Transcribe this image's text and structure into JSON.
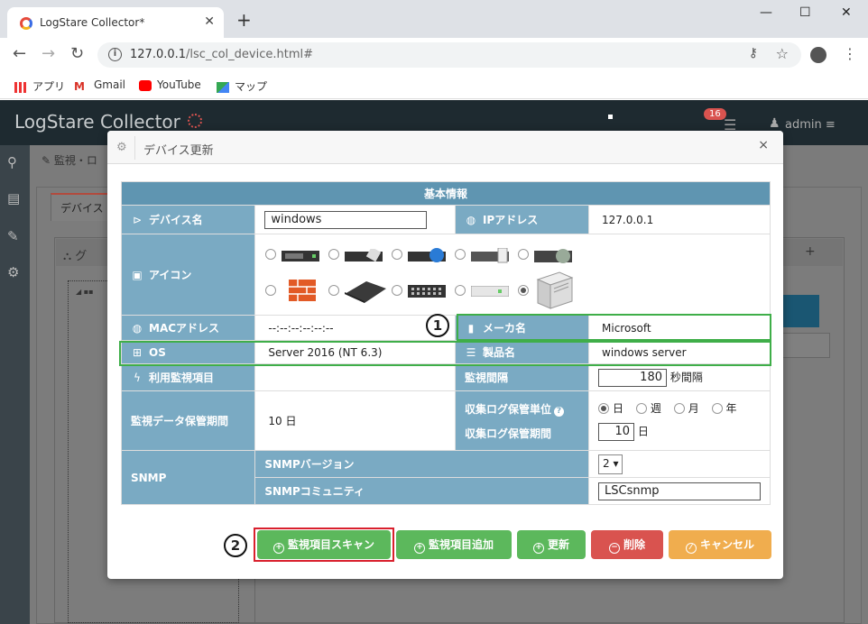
{
  "browser": {
    "tab_title": "LogStare Collector*",
    "url_host": "127.0.0.1",
    "url_path": "/lsc_col_device.html#",
    "bookmarks": [
      "アプリ",
      "Gmail",
      "YouTube",
      "マップ"
    ]
  },
  "app": {
    "title": "LogStare Collector",
    "notification_count": "16",
    "user": "admin",
    "breadcrumb": "監視・ロ",
    "bg_tab": "デバイス",
    "bg_panel_label": "グ"
  },
  "modal": {
    "title": "デバイス更新",
    "close": "×",
    "section_title": "基本情報",
    "rows": {
      "device_name_label": "デバイス名",
      "device_name_value": "windows",
      "ip_label": "IPアドレス",
      "ip_value": "127.0.0.1",
      "icon_label": "アイコン",
      "mac_label": "MACアドレス",
      "mac_value": "--:--:--:--:--:--",
      "maker_label": "メーカ名",
      "maker_value": "Microsoft",
      "os_label": "OS",
      "os_value": "Server 2016 (NT 6.3)",
      "product_label": "製品名",
      "product_value": "windows server",
      "used_items_label": "利用監視項目",
      "interval_label": "監視間隔",
      "interval_value": "180",
      "interval_unit": "秒間隔",
      "retention_label": "監視データ保管期間",
      "retention_value": "10 日",
      "log_unit_label": "収集ログ保管単位",
      "log_period_label": "収集ログ保管期間",
      "log_period_value": "10",
      "log_period_unit": "日",
      "log_unit_options": [
        {
          "label": "日",
          "selected": true
        },
        {
          "label": "週",
          "selected": false
        },
        {
          "label": "月",
          "selected": false
        },
        {
          "label": "年",
          "selected": false
        }
      ],
      "snmp_label": "SNMP",
      "snmp_version_label": "SNMPバージョン",
      "snmp_version_value": "2",
      "snmp_community_label": "SNMPコミュニティ",
      "snmp_community_value": "LSCsnmp"
    },
    "icon_options": [
      {
        "icon": "rack-server-icon",
        "selected": false
      },
      {
        "icon": "router-icon",
        "selected": false
      },
      {
        "icon": "globe-server-icon",
        "selected": false
      },
      {
        "icon": "storage-icon",
        "selected": false
      },
      {
        "icon": "disk-array-icon",
        "selected": false
      },
      {
        "icon": "firewall-icon",
        "selected": false
      },
      {
        "icon": "appliance-icon",
        "selected": false
      },
      {
        "icon": "switch-icon",
        "selected": false
      },
      {
        "icon": "hub-icon",
        "selected": false
      },
      {
        "icon": "tower-server-icon",
        "selected": true
      }
    ],
    "buttons": {
      "scan": "監視項目スキャン",
      "add": "監視項目追加",
      "update": "更新",
      "delete": "削除",
      "cancel": "キャンセル"
    },
    "annotations": {
      "one": "1",
      "two": "2"
    }
  },
  "colors": {
    "header_blue": "#5f95b1",
    "label_blue": "#7aaac3",
    "highlight_green": "#3fae49",
    "highlight_red": "#d9202d",
    "btn_green": "#5cb85c",
    "btn_red": "#d9534f",
    "btn_orange": "#f0ad4e"
  }
}
